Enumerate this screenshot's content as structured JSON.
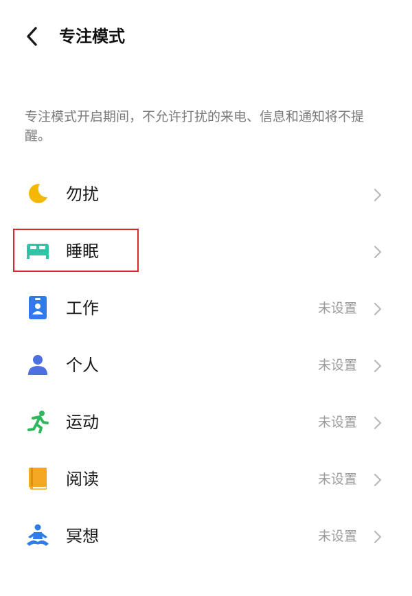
{
  "header": {
    "title": "专注模式",
    "back_icon": "chevron-left-icon"
  },
  "description": "专注模式开启期间，不允许打扰的来电、信息和通知将不提醒。",
  "modes": [
    {
      "label": "勿扰",
      "status": "",
      "icon": "moon-icon",
      "icon_color": "#F5B800"
    },
    {
      "label": "睡眠",
      "status": "",
      "icon": "bed-icon",
      "icon_color": "#2EC4A6"
    },
    {
      "label": "工作",
      "status": "未设置",
      "icon": "badge-icon",
      "icon_color": "#2F7BEA"
    },
    {
      "label": "个人",
      "status": "未设置",
      "icon": "person-icon",
      "icon_color": "#4D6FE0"
    },
    {
      "label": "运动",
      "status": "未设置",
      "icon": "running-icon",
      "icon_color": "#2EB85C"
    },
    {
      "label": "阅读",
      "status": "未设置",
      "icon": "book-icon",
      "icon_color": "#F5A623"
    },
    {
      "label": "冥想",
      "status": "未设置",
      "icon": "meditation-icon",
      "icon_color": "#2F7BEA"
    }
  ],
  "highlight": {
    "target": "睡眠",
    "color": "#D9272E"
  }
}
